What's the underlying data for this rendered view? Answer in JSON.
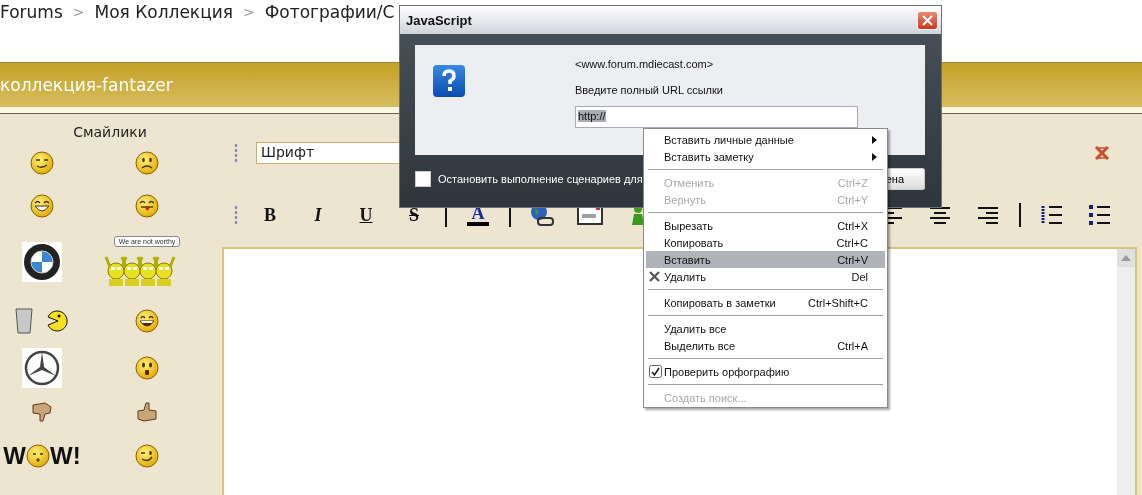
{
  "breadcrumb": [
    {
      "kind": "link",
      "label": "Forums"
    },
    {
      "kind": "separator",
      "label": ">"
    },
    {
      "kind": "link",
      "label": "Моя Коллекция"
    },
    {
      "kind": "separator",
      "label": ">"
    },
    {
      "kind": "link",
      "label": "Фотографии/С"
    }
  ],
  "banner": {
    "title": "коллекция-fantazer"
  },
  "smileys": {
    "title": "Смайлики",
    "items": [
      {
        "kind": "smile"
      },
      {
        "kind": "sad"
      },
      {
        "kind": "laugh"
      },
      {
        "kind": "tongue"
      },
      {
        "kind": "roundel"
      },
      {
        "kind": "worthy",
        "bubble": "We are not worthy"
      },
      {
        "kind": "cup_chomp"
      },
      {
        "kind": "grin"
      },
      {
        "kind": "star_logo"
      },
      {
        "kind": "surprised"
      },
      {
        "kind": "thumbs_down"
      },
      {
        "kind": "thumbs_up"
      },
      {
        "kind": "wow",
        "left": "W",
        "right": "W!"
      },
      {
        "kind": "wink"
      }
    ]
  },
  "editor": {
    "font_field": {
      "value": "Шрифт"
    },
    "toolbar_left": [
      {
        "kind": "bold",
        "label": "B"
      },
      {
        "kind": "italic",
        "label": "I"
      },
      {
        "kind": "underline",
        "label": "U"
      },
      {
        "kind": "strike",
        "label": "S"
      },
      {
        "kind": "separator"
      },
      {
        "kind": "color",
        "label": "A"
      },
      {
        "kind": "separator"
      },
      {
        "kind": "link"
      },
      {
        "kind": "image"
      },
      {
        "kind": "figure"
      }
    ],
    "toolbar_right": [
      {
        "kind": "align_left"
      },
      {
        "kind": "align_center"
      },
      {
        "kind": "align_right"
      },
      {
        "kind": "separator"
      },
      {
        "kind": "ordered_list"
      },
      {
        "kind": "bullet_list"
      }
    ]
  },
  "dialog": {
    "title": "JavaScript",
    "origin": "<www.forum.mdiecast.com>",
    "prompt": "Введите полный URL ссылки",
    "input": {
      "value": "http://",
      "selected": true
    },
    "checkbox": {
      "label": "Остановить выполнение сценариев для",
      "checked": false
    },
    "button": "ена"
  },
  "context_menu": [
    {
      "kind": "item",
      "label": "Вставить личные данные",
      "submenu": true,
      "disabled": false,
      "selected": false
    },
    {
      "kind": "item",
      "label": "Вставить заметку",
      "submenu": true,
      "disabled": false,
      "selected": false
    },
    {
      "kind": "separator"
    },
    {
      "kind": "item",
      "label": "Отменить",
      "shortcut": "Ctrl+Z",
      "disabled": true,
      "selected": false
    },
    {
      "kind": "item",
      "label": "Вернуть",
      "shortcut": "Ctrl+Y",
      "disabled": true,
      "selected": false
    },
    {
      "kind": "separator"
    },
    {
      "kind": "item",
      "label": "Вырезать",
      "shortcut": "Ctrl+X",
      "disabled": false,
      "selected": false
    },
    {
      "kind": "item",
      "label": "Копировать",
      "shortcut": "Ctrl+C",
      "disabled": false,
      "selected": false
    },
    {
      "kind": "item",
      "label": "Вставить",
      "shortcut": "Ctrl+V",
      "disabled": false,
      "selected": true
    },
    {
      "kind": "delete_item",
      "label": "Удалить",
      "shortcut": "Del",
      "disabled": false,
      "selected": false
    },
    {
      "kind": "separator"
    },
    {
      "kind": "item",
      "label": "Копировать в заметки",
      "shortcut": "Ctrl+Shift+C",
      "disabled": false,
      "selected": false
    },
    {
      "kind": "separator"
    },
    {
      "kind": "item",
      "label": "Удалить все",
      "disabled": false,
      "selected": false
    },
    {
      "kind": "item",
      "label": "Выделить все",
      "shortcut": "Ctrl+A",
      "disabled": false,
      "selected": false
    },
    {
      "kind": "separator"
    },
    {
      "kind": "check_item",
      "label": "Проверить орфографию",
      "checked": true,
      "disabled": false,
      "selected": false
    },
    {
      "kind": "separator"
    },
    {
      "kind": "item",
      "label": "Создать поиск...",
      "disabled": true,
      "selected": false
    }
  ]
}
